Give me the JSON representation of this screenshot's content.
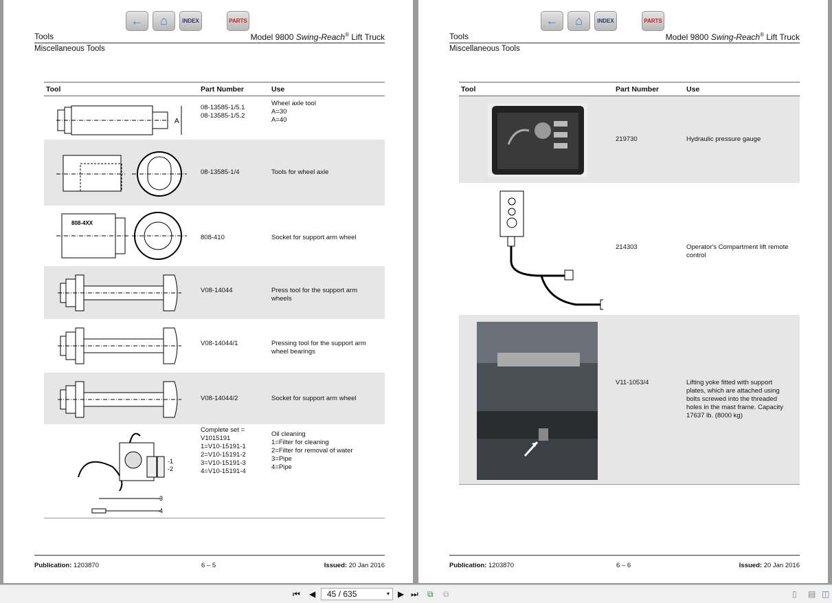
{
  "nav_buttons": [
    {
      "name": "back",
      "label": "←"
    },
    {
      "name": "home",
      "label": "⌂"
    },
    {
      "name": "index",
      "label": "INDEX"
    },
    {
      "name": "parts",
      "label": "PARTS"
    }
  ],
  "pages": [
    {
      "section": "Tools",
      "model": "Model 9800 ",
      "model_italic": "Swing-Reach",
      "model_sup": "®",
      "model_tail": " Lift Truck",
      "subsection": "Miscellaneous Tools",
      "columns": [
        "Tool",
        "Part Number",
        "Use"
      ],
      "rows": [
        {
          "part": "08-13585-1/5.1\n08-13585-1/5.2",
          "use": "Wheel axle tool\nA=30\nA=40",
          "ill": "axle"
        },
        {
          "part": "08-13585-1/4",
          "use": "Tools for wheel axle",
          "ill": "axle2"
        },
        {
          "part": "808-410",
          "use": "Socket for support arm wheel",
          "ill": "socket",
          "ill_label": "808-4XX"
        },
        {
          "part": "V08-14044",
          "use": "Press tool for the support arm wheels",
          "ill": "press"
        },
        {
          "part": "V08-14044/1",
          "use": "Pressing tool for the support arm wheel bearings",
          "ill": "press"
        },
        {
          "part": "V08-14044/2",
          "use": "Socket for support arm wheel",
          "ill": "press"
        },
        {
          "part": "Complete set =\nV1015191\n1=V10-15191-1\n2=V10-15191-2\n3=V10-15191-3\n4=V10-15191-4",
          "use": "Oil cleaning\n1=Filter for cleaning\n2=Filter for removal of water\n3=Pipe\n4=Pipe",
          "ill": "oil",
          "ill_labels": [
            "-1",
            "-2",
            "-3",
            "-4"
          ]
        }
      ],
      "footer": {
        "pub_label": "Publication:",
        "pub": "1203870",
        "page": "6 – 5",
        "issued_label": "Issued:",
        "issued": "20 Jan 2016"
      }
    },
    {
      "section": "Tools",
      "model": "Model 9800 ",
      "model_italic": "Swing-Reach",
      "model_sup": "®",
      "model_tail": " Lift Truck",
      "subsection": "Miscellaneous Tools",
      "columns": [
        "Tool",
        "Part Number",
        "Use"
      ],
      "rows": [
        {
          "part": "219730",
          "use": "Hydraulic pressure gauge",
          "ill": "gauge"
        },
        {
          "part": "214303",
          "use": "Operator's Compartment lift remote control",
          "ill": "remote"
        },
        {
          "part": "V11-1053/4",
          "use": "Lifting yoke fitted with support plates, which are attached using bolts screwed into the threaded holes in the mast frame. Capacity 17637 lb. (8000 kg)",
          "ill": "yoke"
        }
      ],
      "footer": {
        "pub_label": "Publication:",
        "pub": "1203870",
        "page": "6 – 6",
        "issued_label": "Issued:",
        "issued": "20 Jan 2016"
      }
    }
  ],
  "toolbar": {
    "first": "⏮",
    "prev": "◀",
    "page_value": "45 / 635",
    "next": "▶",
    "last": "⏭",
    "dropdown": "▾"
  }
}
